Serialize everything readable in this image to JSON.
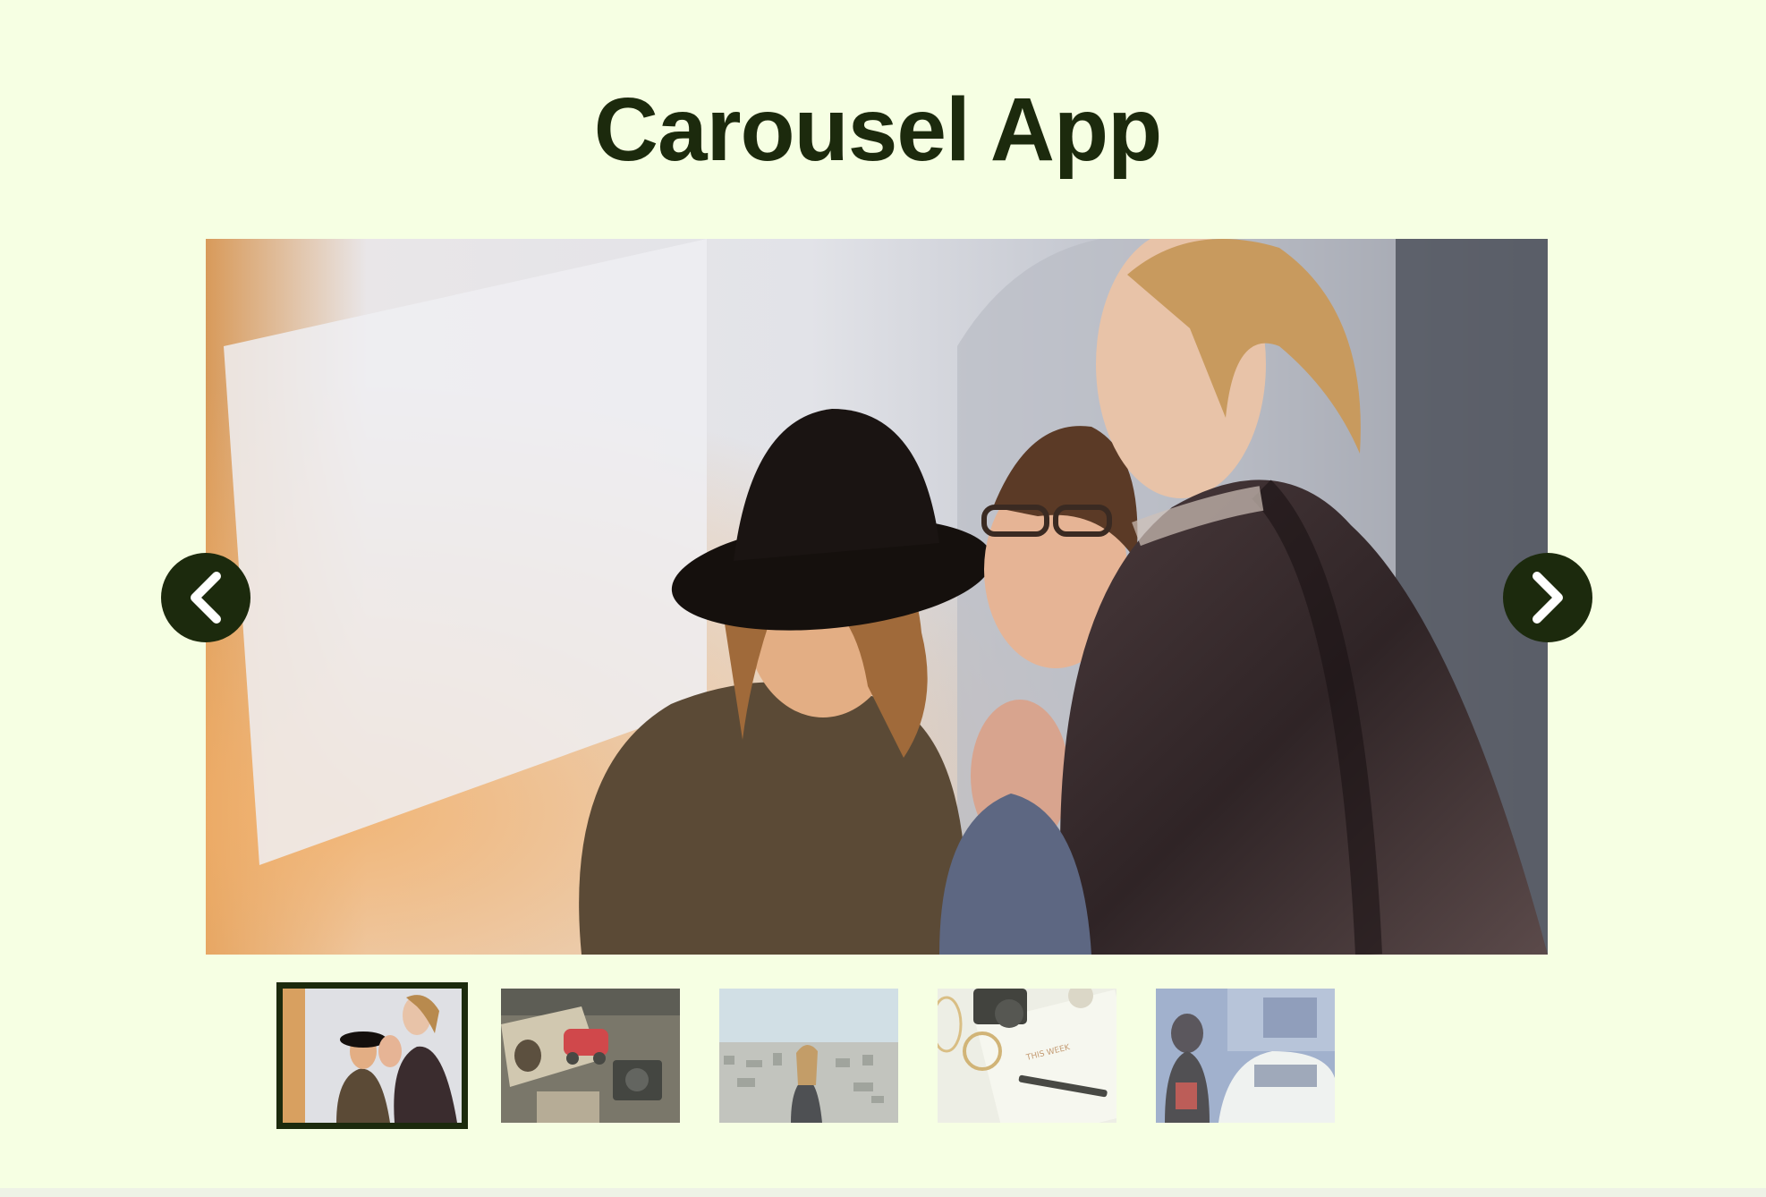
{
  "app": {
    "title": "Carousel App"
  },
  "carousel": {
    "active_index": 0,
    "slide_count": 5,
    "prev_icon": "chevron-left-icon",
    "next_icon": "chevron-right-icon"
  },
  "colors": {
    "background": "#f6ffe3",
    "accent": "#1c2a0d"
  },
  "thumbnails": [
    {
      "subject": "three women laughing outdoors"
    },
    {
      "subject": "toy car and vintage camera on table"
    },
    {
      "subject": "woman overlooking city skyline"
    },
    {
      "subject": "camera and notebook flat lay"
    },
    {
      "subject": "woman near car in parking garage"
    }
  ],
  "thumbnail_texts": {
    "notebook_label": "THIS WEEK"
  }
}
